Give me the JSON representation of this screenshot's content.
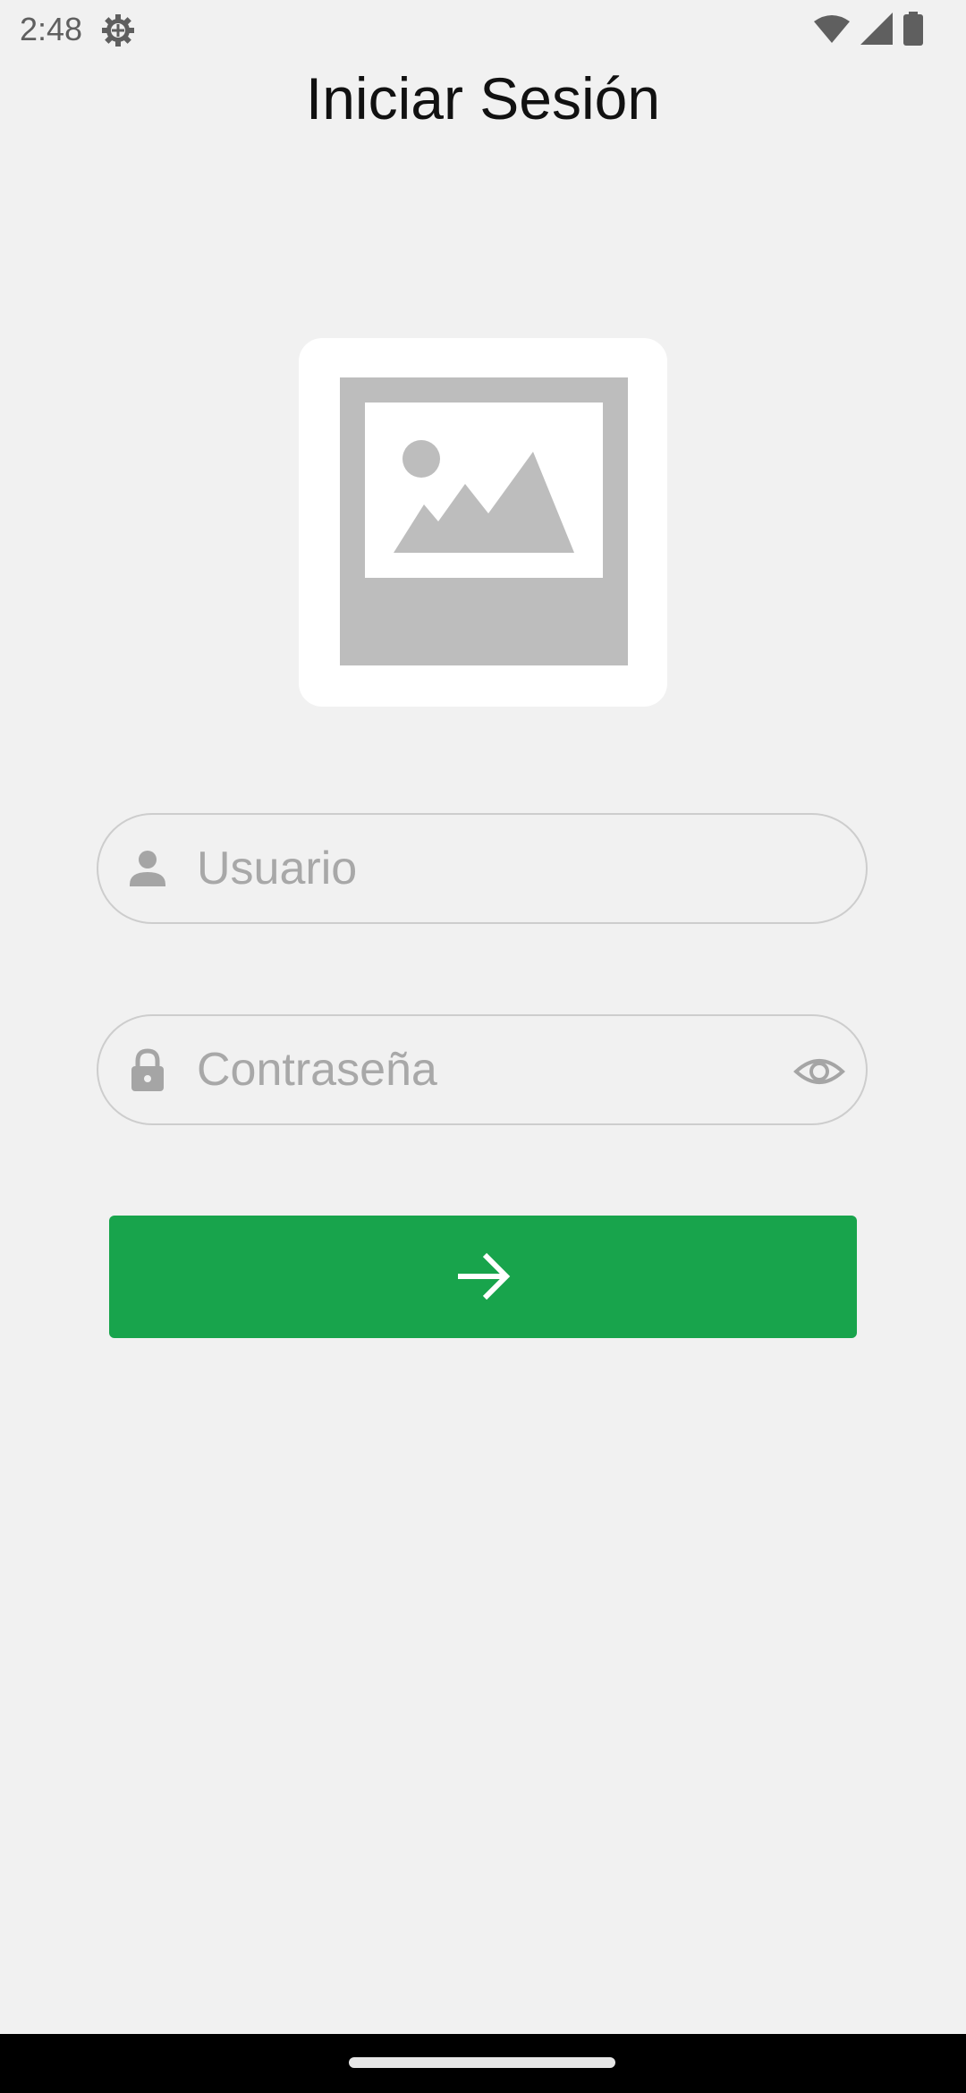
{
  "status_bar": {
    "time": "2:48",
    "icons": [
      "settings-gear-icon",
      "wifi-icon",
      "cellular-signal-icon",
      "battery-icon"
    ]
  },
  "header": {
    "title": "Iniciar Sesión"
  },
  "logo": {
    "icon": "image-placeholder-icon"
  },
  "form": {
    "username": {
      "icon": "person-icon",
      "placeholder": "Usuario",
      "value": ""
    },
    "password": {
      "icon": "lock-icon",
      "placeholder": "Contraseña",
      "value": "",
      "toggle_icon": "eye-icon"
    },
    "submit": {
      "icon": "arrow-right-icon"
    }
  },
  "colors": {
    "background": "#f1f1f1",
    "accent": "#18a44c",
    "field_border": "#cdcdcd",
    "placeholder": "#a8a8a8",
    "icon_gray": "#a5a5a5"
  }
}
